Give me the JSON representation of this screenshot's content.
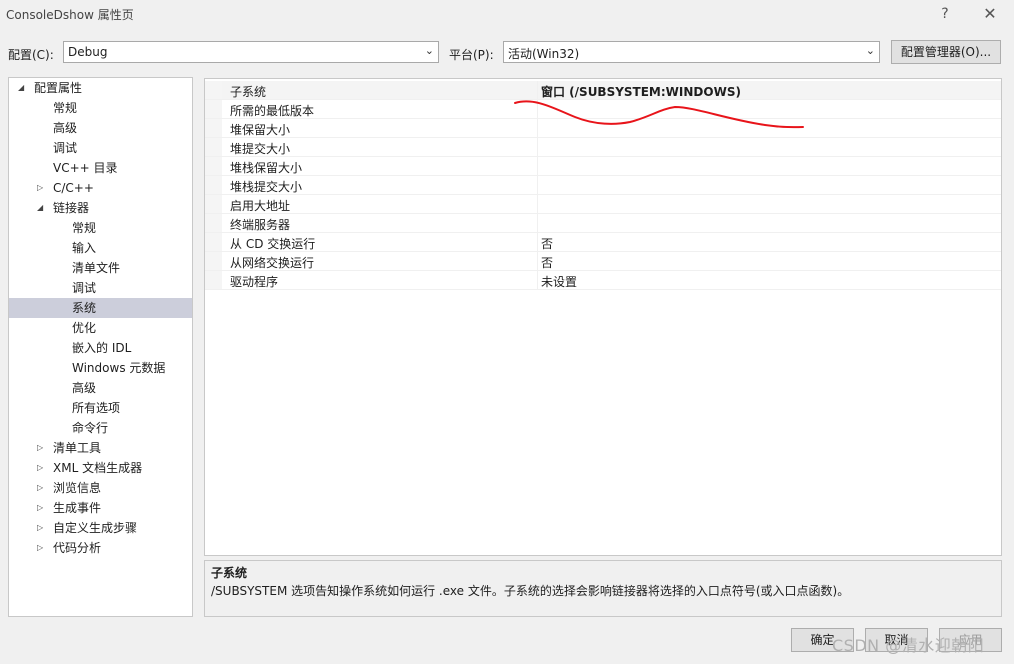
{
  "window": {
    "title": "ConsoleDshow 属性页",
    "help": "?",
    "close": "✕"
  },
  "toolbar": {
    "config_label": "配置(C):",
    "config_value": "Debug",
    "platform_label": "平台(P):",
    "platform_value": "活动(Win32)",
    "config_manager": "配置管理器(O)..."
  },
  "tree": {
    "root": "配置属性",
    "items": [
      "常规",
      "高级",
      "调试",
      "VC++ 目录",
      "C/C++",
      "链接器",
      "常规",
      "输入",
      "清单文件",
      "调试",
      "系统",
      "优化",
      "嵌入的 IDL",
      "Windows 元数据",
      "高级",
      "所有选项",
      "命令行",
      "清单工具",
      "XML 文档生成器",
      "浏览信息",
      "生成事件",
      "自定义生成步骤",
      "代码分析"
    ]
  },
  "properties": [
    {
      "name": "子系统",
      "value": "窗口 (/SUBSYSTEM:WINDOWS)"
    },
    {
      "name": "所需的最低版本",
      "value": ""
    },
    {
      "name": "堆保留大小",
      "value": ""
    },
    {
      "name": "堆提交大小",
      "value": ""
    },
    {
      "name": "堆栈保留大小",
      "value": ""
    },
    {
      "name": "堆栈提交大小",
      "value": ""
    },
    {
      "name": "启用大地址",
      "value": ""
    },
    {
      "name": "终端服务器",
      "value": ""
    },
    {
      "name": "从 CD 交换运行",
      "value": "否"
    },
    {
      "name": "从网络交换运行",
      "value": "否"
    },
    {
      "name": "驱动程序",
      "value": "未设置"
    }
  ],
  "description": {
    "title": "子系统",
    "text": "/SUBSYSTEM 选项告知操作系统如何运行 .exe 文件。子系统的选择会影响链接器将选择的入口点符号(或入口点函数)。"
  },
  "buttons": {
    "ok": "确定",
    "cancel": "取消",
    "apply": "应用"
  },
  "watermark": "CSDN @清水迎朝阳",
  "colors": {
    "selection": "#cccedb",
    "annotation": "#e8141a"
  }
}
